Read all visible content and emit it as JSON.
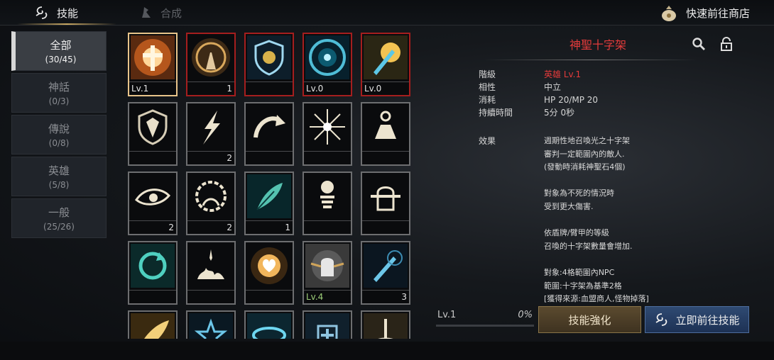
{
  "tabs": {
    "skill": "技能",
    "craft": "合成"
  },
  "shop": {
    "label": "快速前往商店"
  },
  "sidebar": {
    "items": [
      {
        "name": "全部",
        "count": "(30/45)",
        "active": true
      },
      {
        "name": "神話",
        "count": "(0/3)",
        "active": false
      },
      {
        "name": "傳說",
        "count": "(0/8)",
        "active": false
      },
      {
        "name": "英雄",
        "count": "(5/8)",
        "active": false
      },
      {
        "name": "一般",
        "count": "(25/26)",
        "active": false
      }
    ]
  },
  "grid": {
    "cells": [
      {
        "icon": "holy-cross-icon",
        "lv": "Lv.1",
        "count": "",
        "border": "selected"
      },
      {
        "icon": "praying-hands-icon",
        "lv": "",
        "count": "1",
        "border": "red"
      },
      {
        "icon": "holy-shield-icon",
        "lv": "",
        "count": "",
        "border": "red"
      },
      {
        "icon": "light-orb-icon",
        "lv": "Lv.0",
        "count": "",
        "border": "red"
      },
      {
        "icon": "radiant-sword-icon",
        "lv": "Lv.0",
        "count": "",
        "border": "red"
      },
      {
        "icon": "shield-icon",
        "lv": "",
        "count": "",
        "border": "gray"
      },
      {
        "icon": "lightning-icon",
        "lv": "",
        "count": "2",
        "border": "gray"
      },
      {
        "icon": "curved-arrow-icon",
        "lv": "",
        "count": "",
        "border": "gray"
      },
      {
        "icon": "starburst-icon",
        "lv": "",
        "count": "",
        "border": "gray"
      },
      {
        "icon": "altar-icon",
        "lv": "",
        "count": "",
        "border": "gray"
      },
      {
        "icon": "eye-icon",
        "lv": "",
        "count": "2",
        "border": "gray"
      },
      {
        "icon": "thorn-head-icon",
        "lv": "",
        "count": "2",
        "border": "gray"
      },
      {
        "icon": "feather-icon",
        "lv": "",
        "count": "1",
        "border": "gray"
      },
      {
        "icon": "orb-pillar-icon",
        "lv": "",
        "count": "",
        "border": "gray"
      },
      {
        "icon": "knight-helm-icon",
        "lv": "",
        "count": "",
        "border": "gray"
      },
      {
        "icon": "refresh-icon",
        "lv": "",
        "count": "",
        "border": "gray"
      },
      {
        "icon": "flame-sparkle-icon",
        "lv": "",
        "count": "",
        "border": "gray"
      },
      {
        "icon": "radiant-heart-icon",
        "lv": "",
        "count": "",
        "border": "gray"
      },
      {
        "icon": "winged-helm-icon",
        "lv": "Lv.4",
        "count": "",
        "border": "gray",
        "lvColor": "green"
      },
      {
        "icon": "sword-icon",
        "lv": "",
        "count": "3",
        "border": "gray"
      },
      {
        "icon": "golden-feather-icon",
        "lv": "",
        "count": "",
        "border": "gray"
      },
      {
        "icon": "star-burst-icon",
        "lv": "",
        "count": "",
        "border": "gray"
      },
      {
        "icon": "ring-icon",
        "lv": "",
        "count": "",
        "border": "gray"
      },
      {
        "icon": "cross-badge-icon",
        "lv": "",
        "count": "",
        "border": "gray"
      },
      {
        "icon": "sword-pedestal-icon",
        "lv": "",
        "count": "",
        "border": "gray"
      }
    ]
  },
  "detail": {
    "title": "神聖十字架",
    "props": [
      {
        "key": "階級",
        "value": "英雄 Lv.1"
      },
      {
        "key": "相性",
        "value": "中立"
      },
      {
        "key": "消耗",
        "value": "HP 20/MP 20"
      },
      {
        "key": "持續時間",
        "value": "5分 0秒"
      }
    ],
    "effect_label": "效果",
    "effect_lines": [
      "週期性地召喚光之十字架",
      "審判一定範圍內的敵人.",
      "(發動時消耗神聖石4個)",
      "",
      "對象為不死的情況時",
      "受到更大傷害.",
      "",
      "依盾牌/臂甲的等級",
      "召喚的十字架數量會增加.",
      "",
      "對象:4格範圍內NPC",
      "範圍:十字架為基準2格",
      "[獲得來源:血盟商人,怪物掉落]"
    ]
  },
  "progress": {
    "level": "Lv.1",
    "percent": "0%",
    "fraction": 0
  },
  "buttons": {
    "enhance": "技能強化",
    "goto": "立即前往技能"
  },
  "colors": {
    "accent_gold": "#c9a862",
    "red_border": "#a51e1e",
    "title_red": "#e33b3b",
    "blue_button": "#2f4a72"
  }
}
